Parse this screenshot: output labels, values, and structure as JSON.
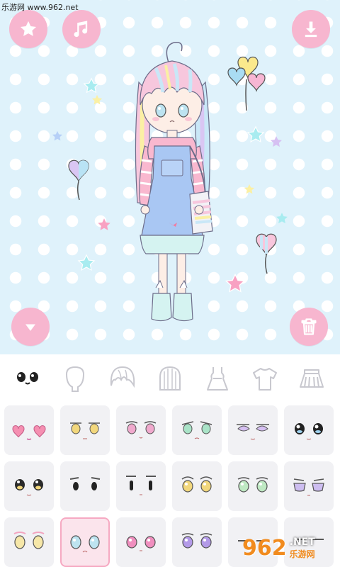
{
  "watermark": {
    "text": "乐游网 www.962.net"
  },
  "top_buttons": {
    "favorite": "star-icon",
    "music": "music-note-icon",
    "download": "download-icon"
  },
  "side_buttons": {
    "collapse": "chevron-down-icon",
    "delete": "trash-icon"
  },
  "colors": {
    "pink": "#f7b6cf",
    "stage_bg": "#dff2fb",
    "selected_border": "#f6a9c2"
  },
  "category_tabs": [
    {
      "id": "eyes",
      "icon": "eyes-face-icon",
      "active": true
    },
    {
      "id": "face",
      "icon": "face-shape-icon",
      "active": false
    },
    {
      "id": "bangs",
      "icon": "bangs-hair-icon",
      "active": false
    },
    {
      "id": "back-hair",
      "icon": "back-hair-icon",
      "active": false
    },
    {
      "id": "dress",
      "icon": "dress-icon",
      "active": false
    },
    {
      "id": "top",
      "icon": "tshirt-icon",
      "active": false
    },
    {
      "id": "skirt",
      "icon": "skirt-icon",
      "active": false
    }
  ],
  "eye_options": {
    "selected_index": 13,
    "count": 18
  },
  "logo": {
    "number": "962",
    "net": ".NET",
    "site": "乐游网"
  }
}
